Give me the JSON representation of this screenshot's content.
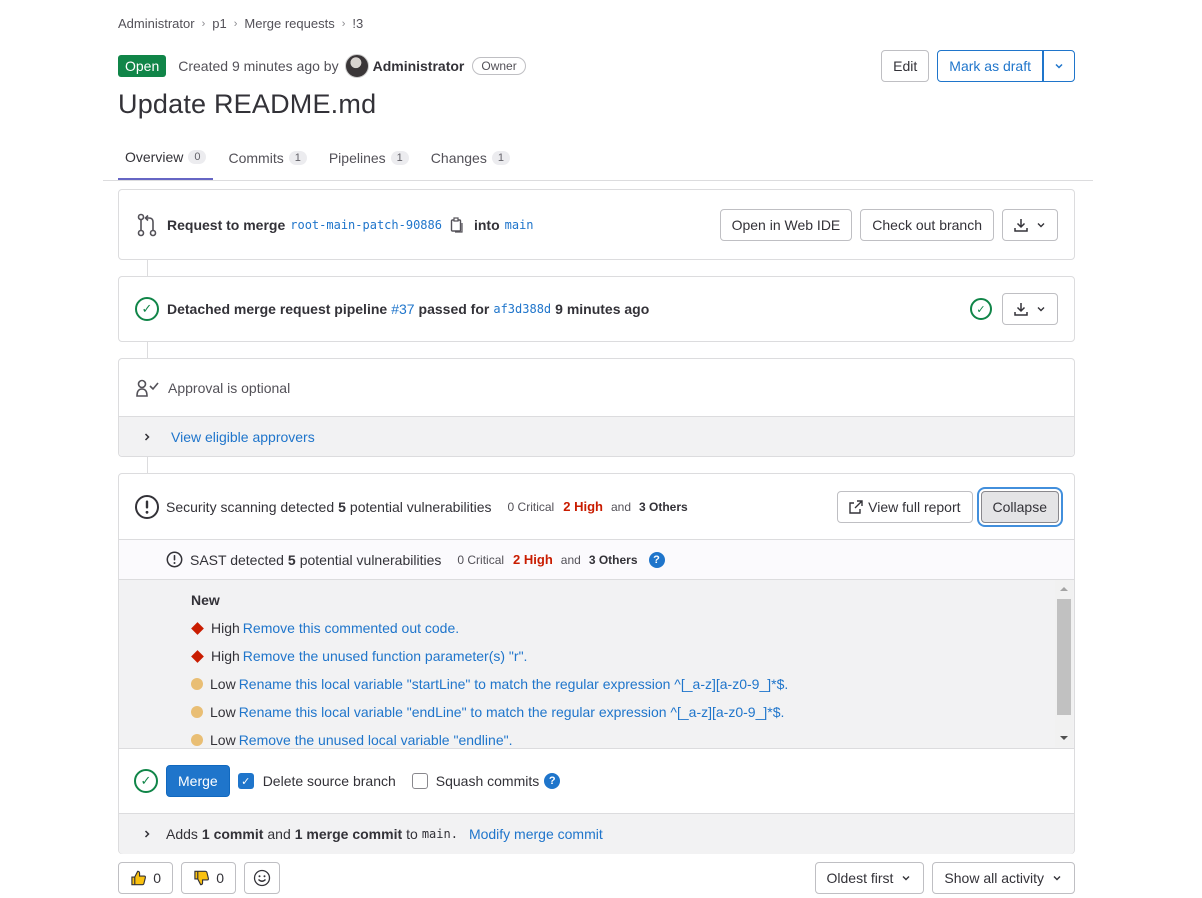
{
  "breadcrumb": [
    "Administrator",
    "p1",
    "Merge requests",
    "!3"
  ],
  "header": {
    "status": "Open",
    "created": "Created 9 minutes ago by",
    "author": "Administrator",
    "role": "Owner",
    "edit": "Edit",
    "mark_draft": "Mark as draft"
  },
  "title": "Update README.md",
  "tabs": [
    {
      "label": "Overview",
      "count": "0"
    },
    {
      "label": "Commits",
      "count": "1"
    },
    {
      "label": "Pipelines",
      "count": "1"
    },
    {
      "label": "Changes",
      "count": "1"
    }
  ],
  "request": {
    "prefix": "Request to merge",
    "source": "root-main-patch-90886",
    "into": "into",
    "target": "main",
    "web_ide": "Open in Web IDE",
    "checkout": "Check out branch"
  },
  "pipeline": {
    "prefix": "Detached merge request pipeline",
    "id": "#37",
    "passed": "passed for",
    "sha": "af3d388d",
    "time": "9 minutes ago"
  },
  "approval": {
    "text": "Approval is optional",
    "link": "View eligible approvers"
  },
  "security": {
    "t1": "Security scanning detected",
    "count": "5",
    "t2": "potential vulnerabilities",
    "critical": "0 Critical",
    "high": "2 High",
    "and": "and",
    "others": "3 Others",
    "view_report": "View full report",
    "collapse": "Collapse"
  },
  "sast": {
    "t1": "SAST detected",
    "count": "5",
    "t2": "potential vulnerabilities",
    "critical": "0 Critical",
    "high": "2 High",
    "and": "and",
    "others": "3 Others",
    "new_label": "New",
    "items": [
      {
        "severity": "High",
        "text": "Remove this commented out code."
      },
      {
        "severity": "High",
        "text": "Remove the unused function parameter(s) \"r\"."
      },
      {
        "severity": "Low",
        "text": "Rename this local variable \"startLine\" to match the regular expression ^[_a-z][a-z0-9_]*$."
      },
      {
        "severity": "Low",
        "text": "Rename this local variable \"endLine\" to match the regular expression ^[_a-z][a-z0-9_]*$."
      },
      {
        "severity": "Low",
        "text": "Remove the unused local variable \"endline\"."
      }
    ]
  },
  "merge": {
    "button": "Merge",
    "delete_source": "Delete source branch",
    "squash": "Squash commits",
    "adds": "Adds",
    "commit_count": "1 commit",
    "and": "and",
    "merge_commit": "1 merge commit",
    "to": "to",
    "branch": "main.",
    "modify": "Modify merge commit"
  },
  "footer": {
    "thumbs_up": "0",
    "thumbs_down": "0",
    "sort": "Oldest first",
    "activity": "Show all activity"
  },
  "colors": {
    "accent": "#1f75cb",
    "success": "#108548",
    "danger": "#c91c00",
    "warning": "#e9be74"
  }
}
